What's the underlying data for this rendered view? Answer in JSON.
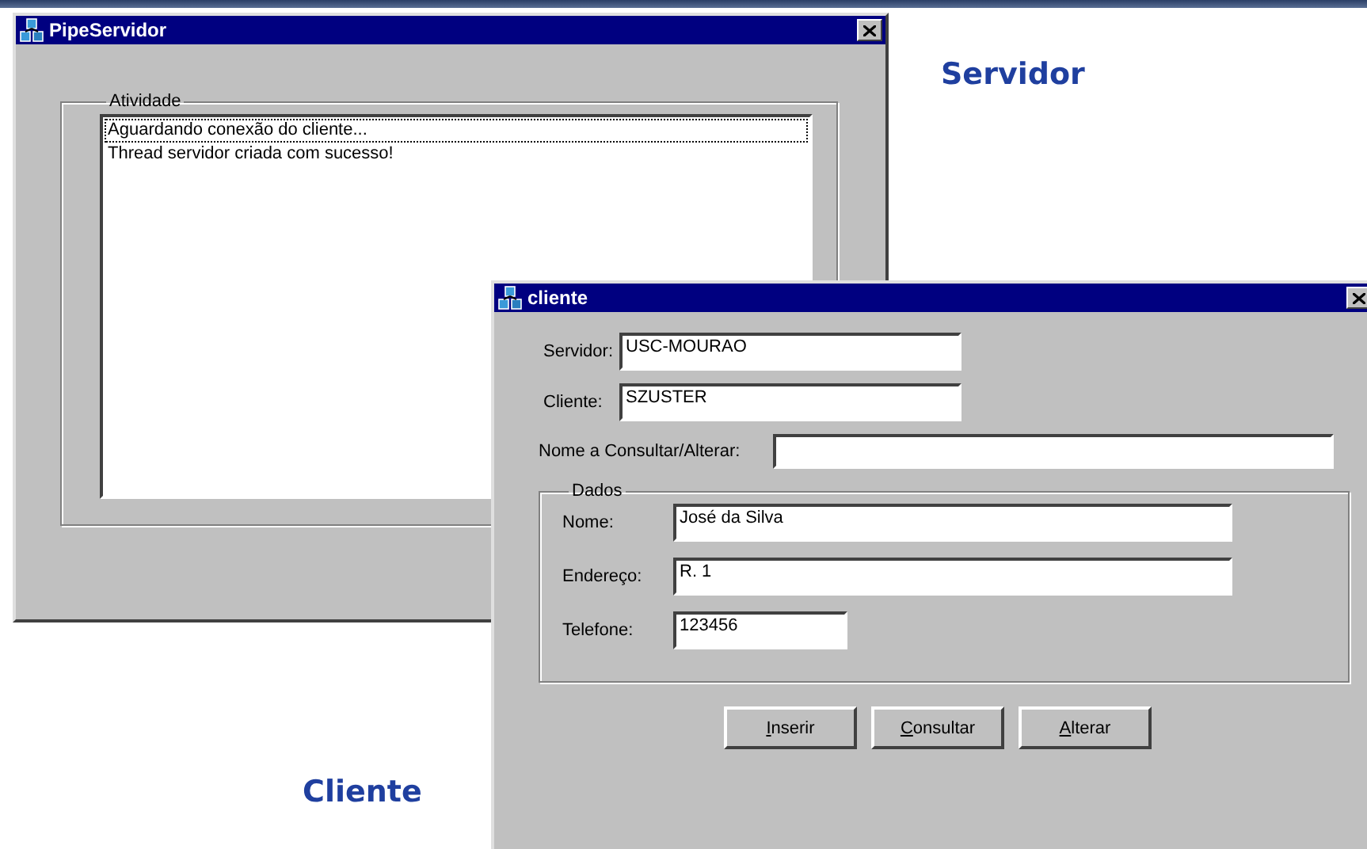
{
  "server_window": {
    "title": "PipeServidor",
    "group_label": "Atividade",
    "log": [
      {
        "text": "Aguardando conexão do cliente...",
        "focused": true
      },
      {
        "text": "Thread servidor criada com sucesso!",
        "focused": false
      }
    ]
  },
  "server_caption": "Servidor",
  "client_window": {
    "title": "cliente",
    "fields": [
      {
        "label": "Servidor:",
        "value": "USC-MOURAO"
      },
      {
        "label": "Cliente:",
        "value": "SZUSTER"
      },
      {
        "label": "Nome a Consultar/Alterar:"
      }
    ],
    "group": {
      "label": "Dados",
      "fields": [
        {
          "label": "Nome:",
          "value": "José da Silva"
        },
        {
          "label": "Endereço:",
          "value": "R. 1"
        },
        {
          "label": "Telefone:",
          "value": "123456"
        }
      ]
    },
    "buttons": [
      {
        "label": "Inserir",
        "mnemonic_first": true
      },
      {
        "label": "Consultar",
        "mnemonic_first": true
      },
      {
        "label": "Alterar",
        "mnemonic_first": true
      }
    ]
  },
  "client_caption": "Cliente"
}
